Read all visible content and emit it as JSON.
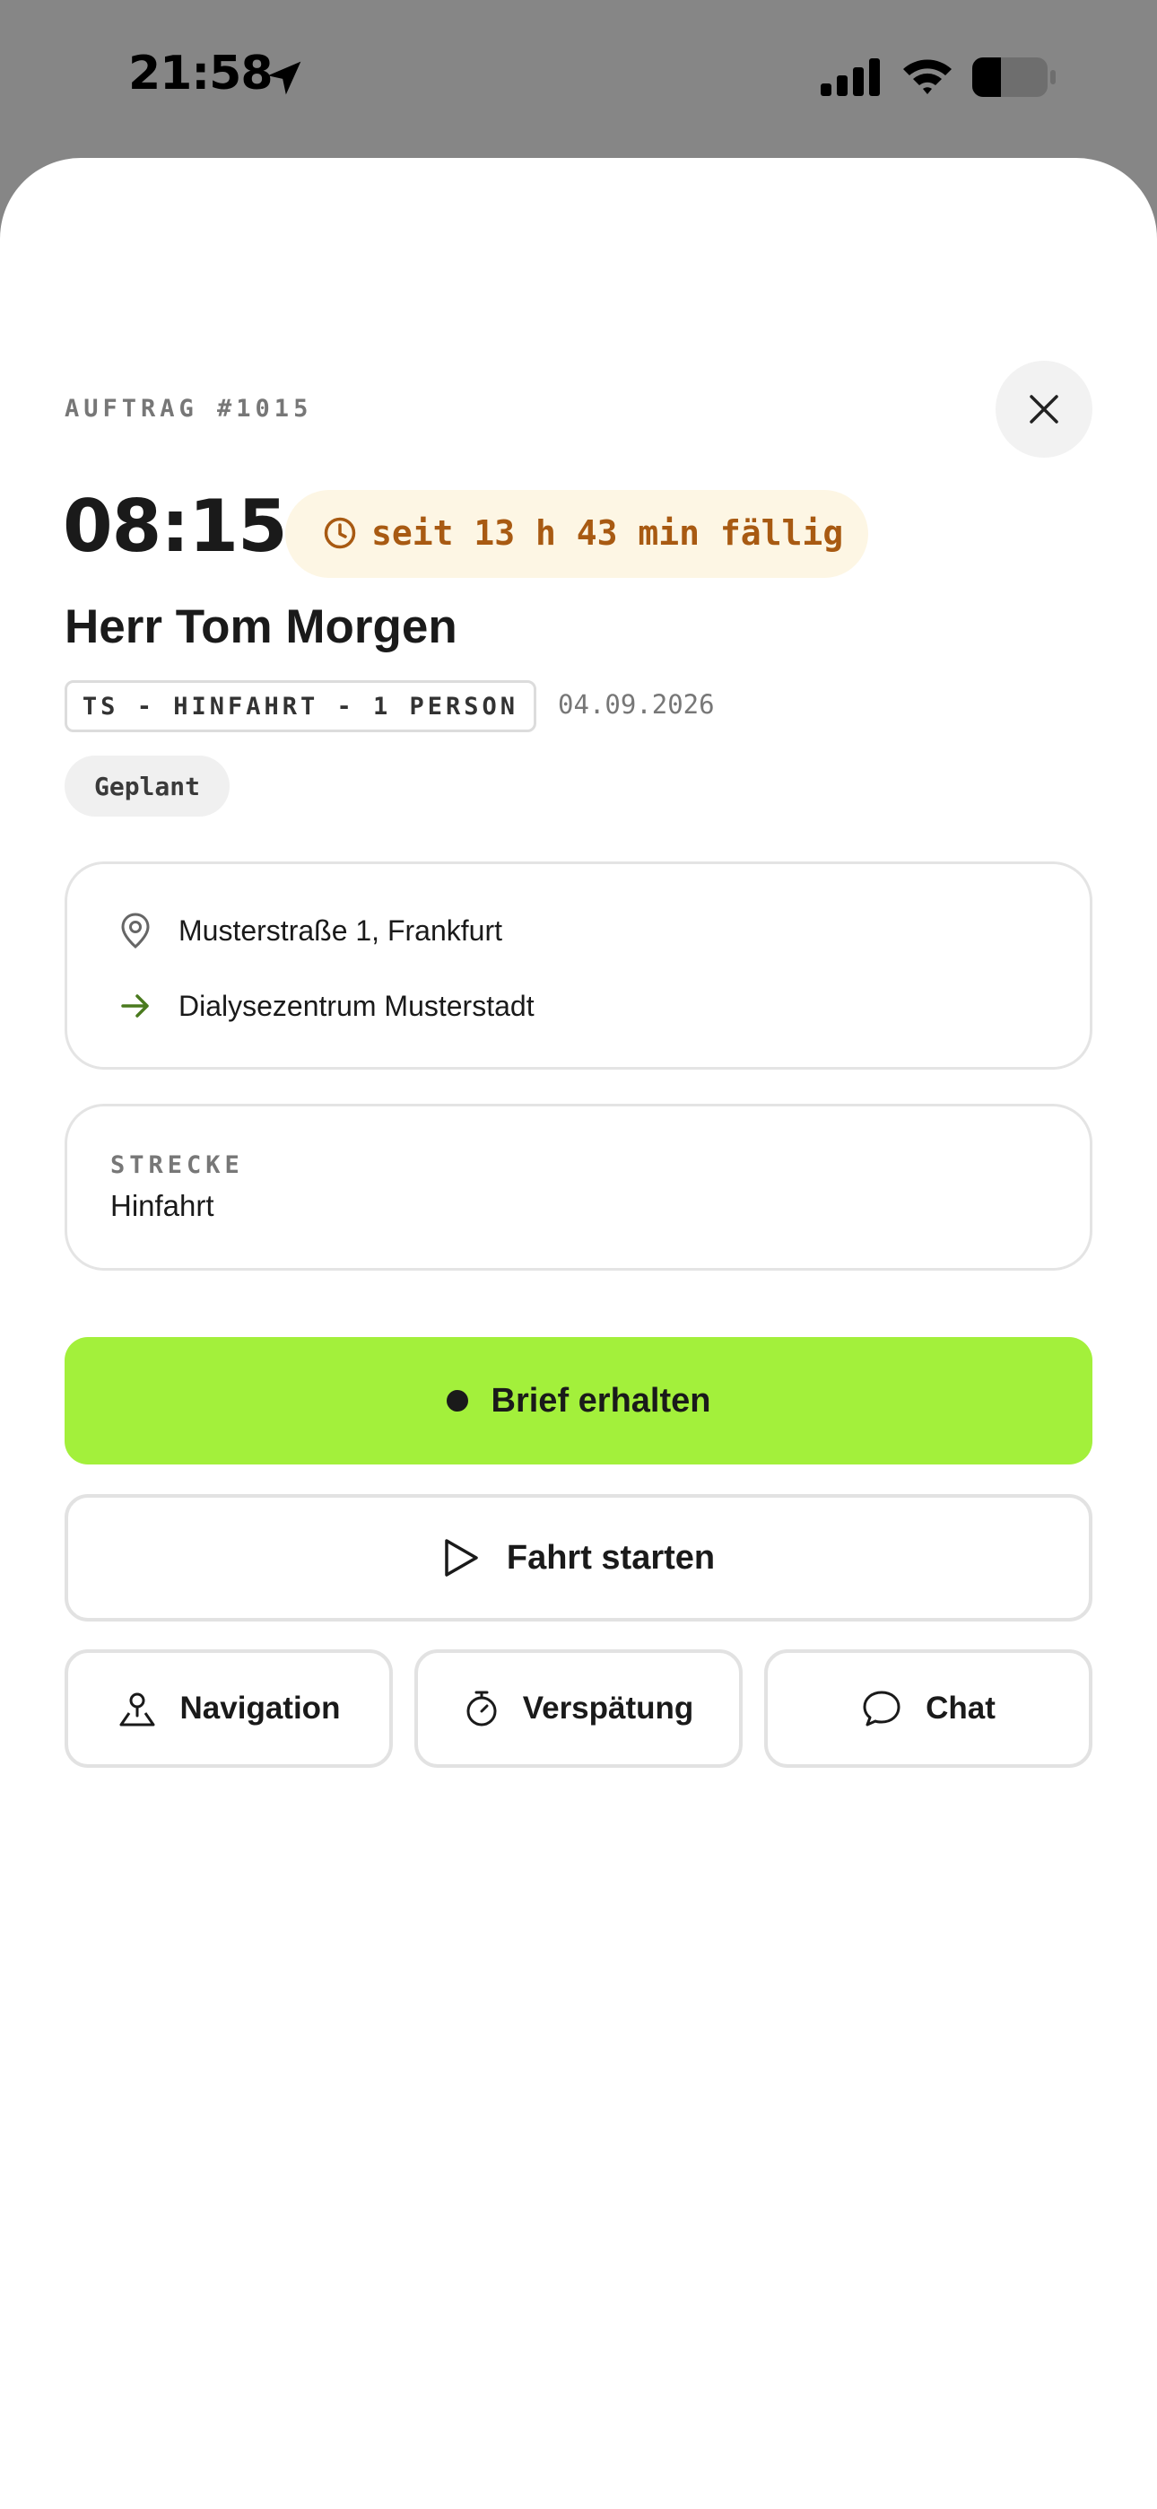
{
  "status_bar": {
    "time": "21:58",
    "battery": "35"
  },
  "order": {
    "label": "AUFTRAG #1015",
    "time": "08:15",
    "overdue_text": "seit 13 h 43 min fällig",
    "patient": "Herr Tom Morgen",
    "trip_tag": "TS - HINFAHRT - 1 PERSON",
    "date": "04.09.2026",
    "status": "Geplant"
  },
  "addresses": {
    "pickup": "Musterstraße 1, Frankfurt",
    "destination": "Dialysezentrum Musterstadt"
  },
  "route": {
    "label": "STRECKE",
    "value": "Hinfahrt"
  },
  "actions": {
    "primary": "Brief erhalten",
    "start": "Fahrt starten",
    "navigation": "Navigation",
    "delay": "Verspätung",
    "chat": "Chat"
  },
  "colors": {
    "accent": "#a3f03b",
    "overdue_bg": "#fdf6e4",
    "overdue_text": "#a85a12",
    "destination_arrow": "#4a7a1e"
  },
  "icons": {
    "close": "close-icon",
    "clock": "clock-icon",
    "pickup": "map-pin-icon",
    "destination": "arrow-right-icon",
    "start": "play-icon",
    "navigation": "map-person-icon",
    "delay": "stopwatch-icon",
    "chat": "chat-bubble-icon"
  }
}
